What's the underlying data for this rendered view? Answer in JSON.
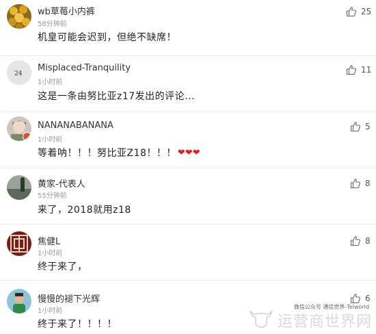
{
  "comments": [
    {
      "username": "wb草莓小内裤",
      "time": "58分钟前",
      "text": "机皇可能会迟到，但绝不缺席！",
      "likes": "25"
    },
    {
      "username": "Misplaced-Tranquility",
      "time": "1小时前",
      "text": "这是一条由努比亚z17发出的评论...",
      "likes": "11"
    },
    {
      "username": "NANANABANANA",
      "time": "1小时前",
      "text": "等着呐！！！努比亚Z18！！！",
      "likes": "5",
      "hearts": "❤❤❤"
    },
    {
      "username": "黄家-代表人",
      "time": "55分钟前",
      "text": "来了，2018就用z18",
      "likes": "8"
    },
    {
      "username": "焦健L",
      "time": "1小时前",
      "text": "终于来了，",
      "likes": "8"
    },
    {
      "username": "慢慢的褪下光辉",
      "time": "1小时前",
      "text": "终于来了！！！！",
      "likes": "6"
    }
  ],
  "watermark": {
    "small": "微信公众号 通信世界-Telworld",
    "big": "运营商世界网"
  }
}
